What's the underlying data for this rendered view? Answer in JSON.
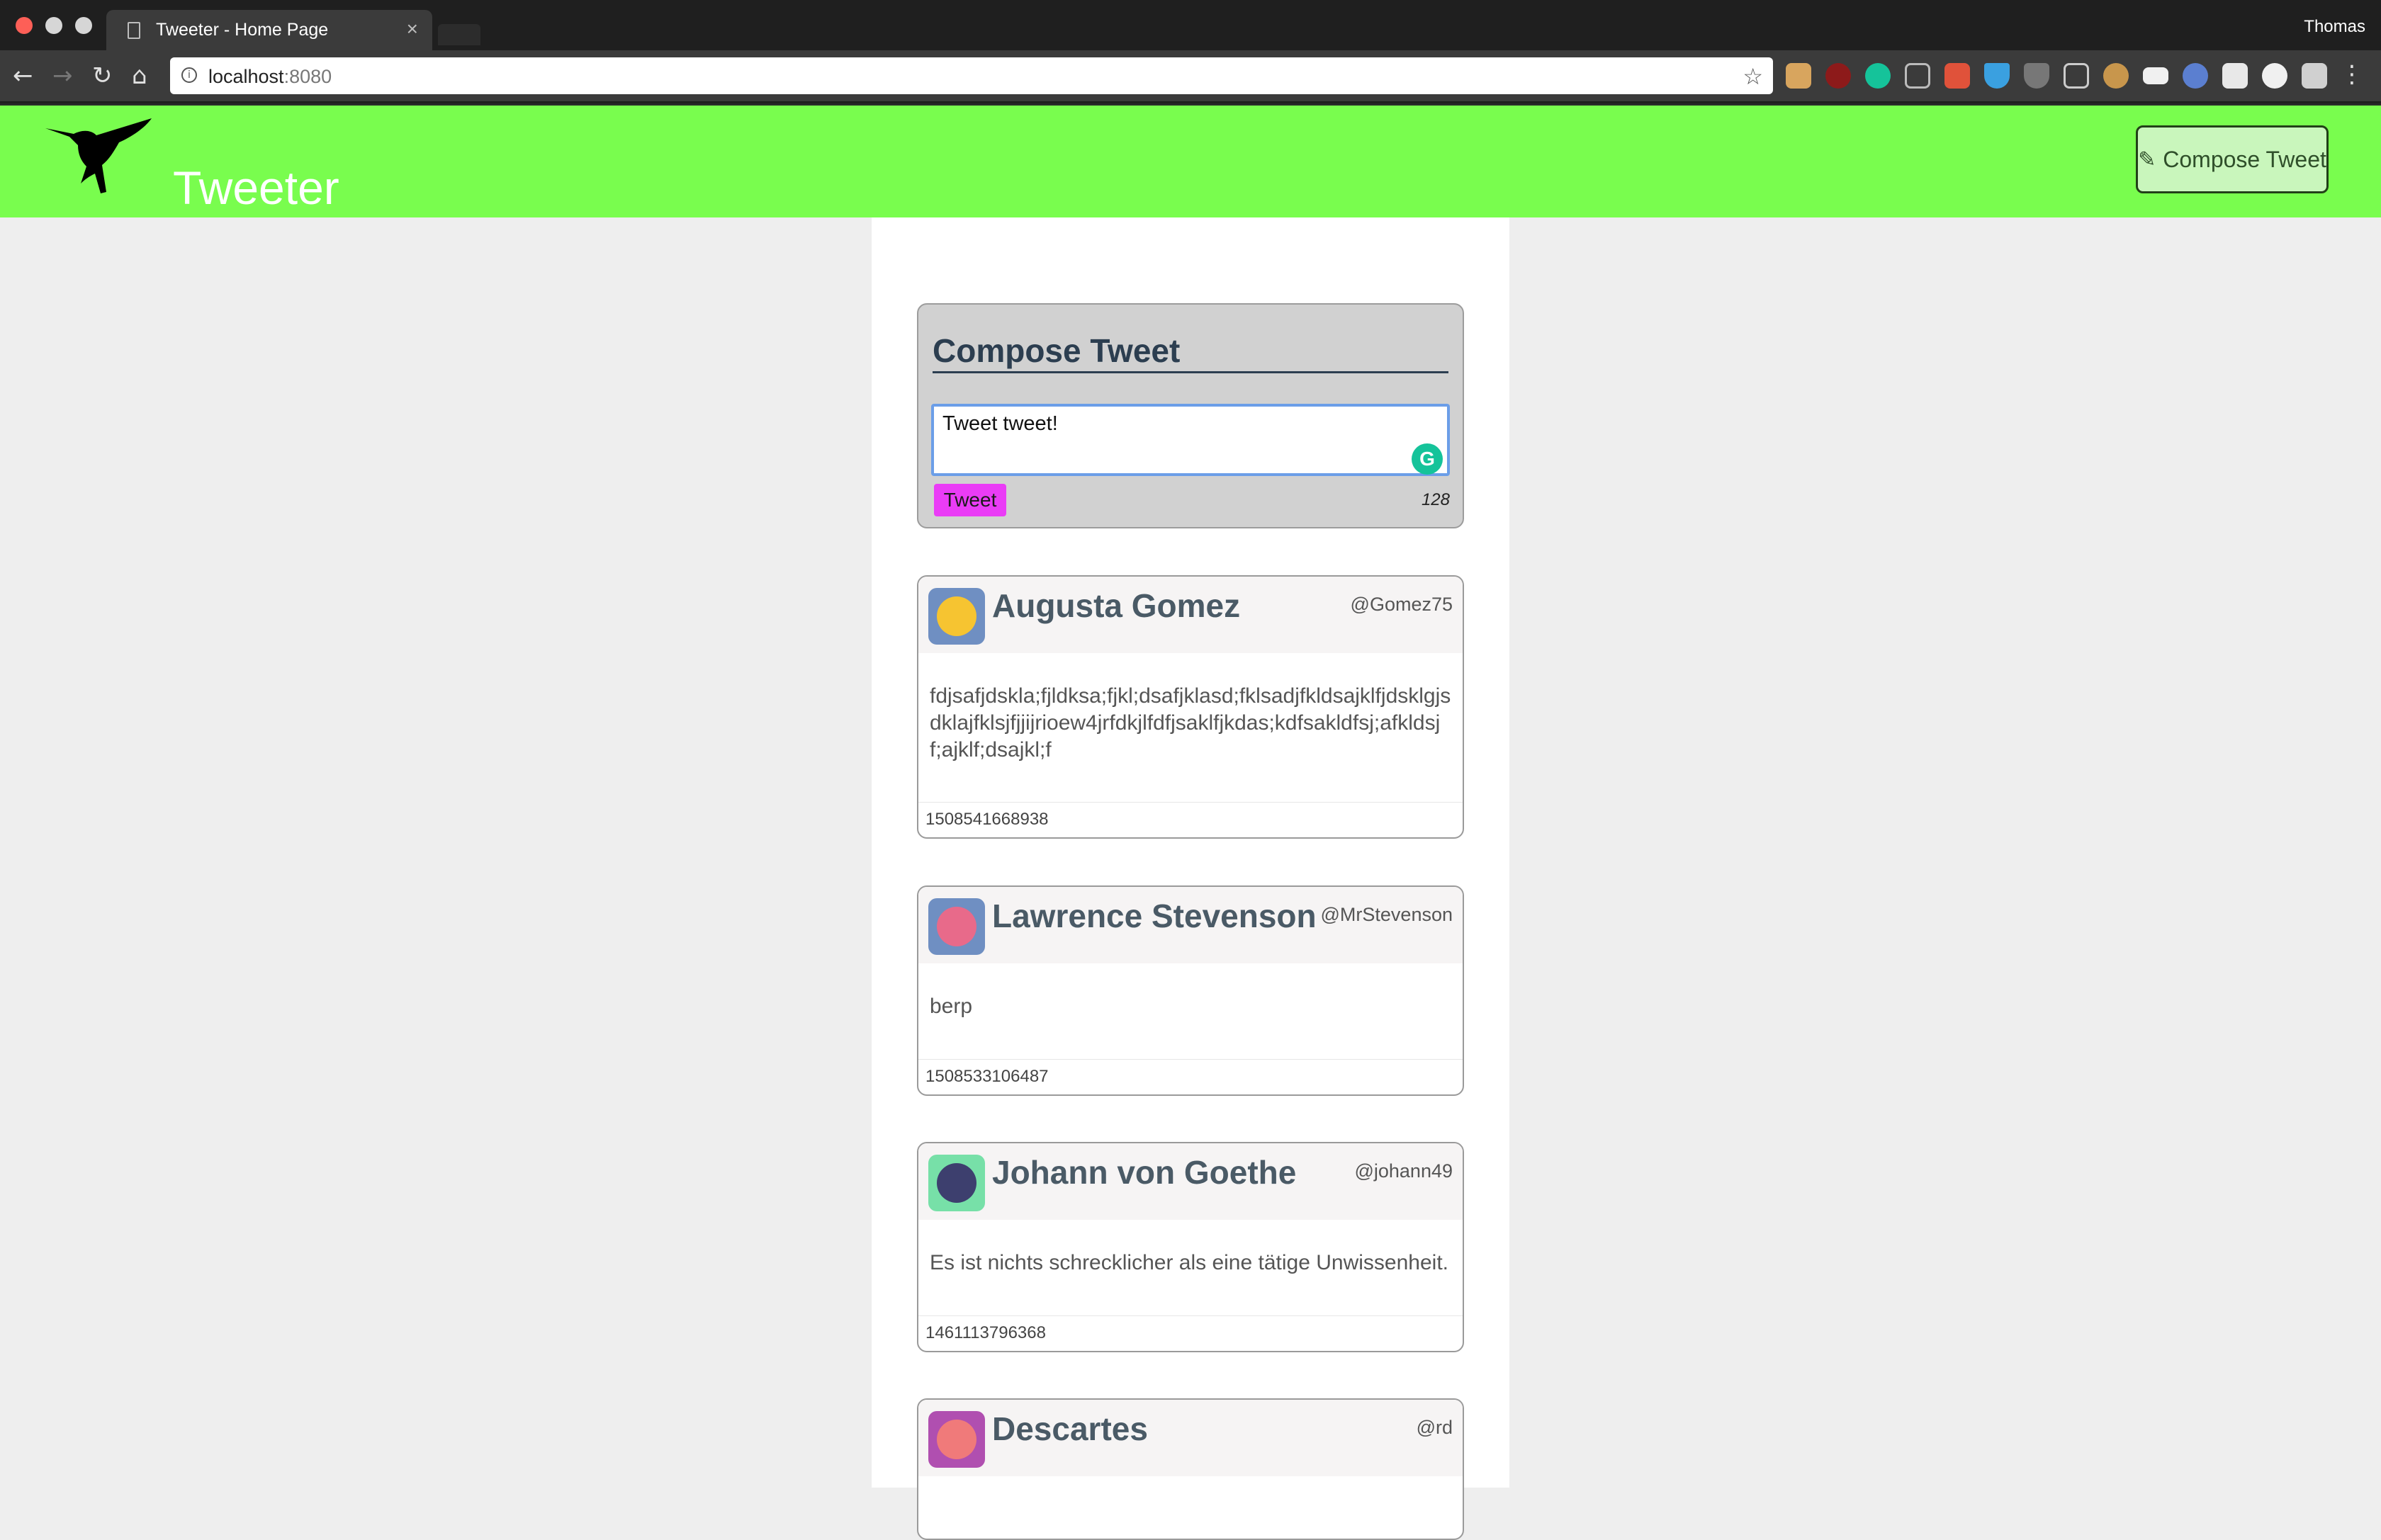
{
  "browser": {
    "tab_title": "Tweeter - Home Page",
    "tab_close": "×",
    "profile_name": "Thomas",
    "url_host": "localhost",
    "url_port": ":8080"
  },
  "header": {
    "brand": "Tweeter",
    "compose_button": "Compose Tweet"
  },
  "compose": {
    "title": "Compose Tweet",
    "text": "Tweet tweet!",
    "submit_label": "Tweet",
    "counter": "128"
  },
  "tweets": [
    {
      "name": "Augusta Gomez",
      "handle": "@Gomez75",
      "content": "fdjsafjdskla;fjldksa;fjkl;dsafjklasd;fklsadjfkldsajklfjdsklgjsdklajfklsjfjjijrioew4jrfdkjlfdfjsaklfjkdas;kdfsakldfsj;afkldsjf;ajklf;dsajkl;f",
      "timestamp": "1508541668938",
      "avatar_color": "#6f8fc2"
    },
    {
      "name": "Lawrence Stevenson",
      "handle": "@MrStevenson",
      "content": "berp",
      "timestamp": "1508533106487",
      "avatar_color": "#6f8fc2"
    },
    {
      "name": "Johann von Goethe",
      "handle": "@johann49",
      "content": "Es ist nichts schrecklicher als eine tätige Unwissenheit.",
      "timestamp": "1461113796368",
      "avatar_color": "#77e0a8"
    },
    {
      "name": "Descartes",
      "handle": "@rd",
      "content": "",
      "timestamp": "",
      "avatar_color": "#b04fb0"
    }
  ],
  "colors": {
    "header_bg": "#79fd4e",
    "tweet_button": "#ea3cf6",
    "page_bg": "#eeeeee"
  }
}
